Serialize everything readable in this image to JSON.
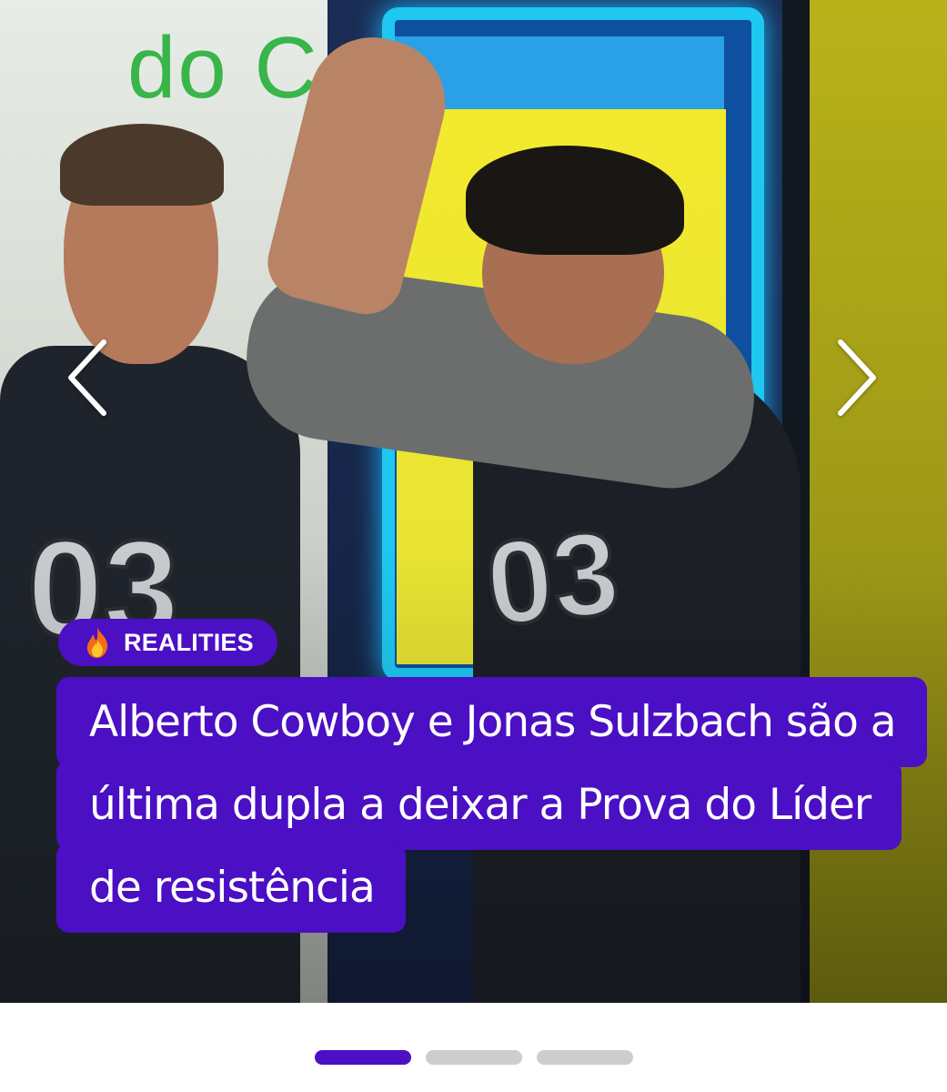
{
  "slide": {
    "category": {
      "icon": "fire-icon",
      "label": "REALITIES"
    },
    "headline": "Alberto Cowboy e Jonas Sulzbach são a última dupla a deixar a Prova do Líder de resistência",
    "background_sign_text": "do C",
    "jersey_number": "03"
  },
  "navigation": {
    "prev_icon": "chevron-left-icon",
    "next_icon": "chevron-right-icon"
  },
  "pagination": {
    "total": 3,
    "active_index": 0
  },
  "colors": {
    "accent": "#4b0fc4",
    "dot_inactive": "#cdcdcd",
    "text_on_accent": "#ffffff"
  }
}
